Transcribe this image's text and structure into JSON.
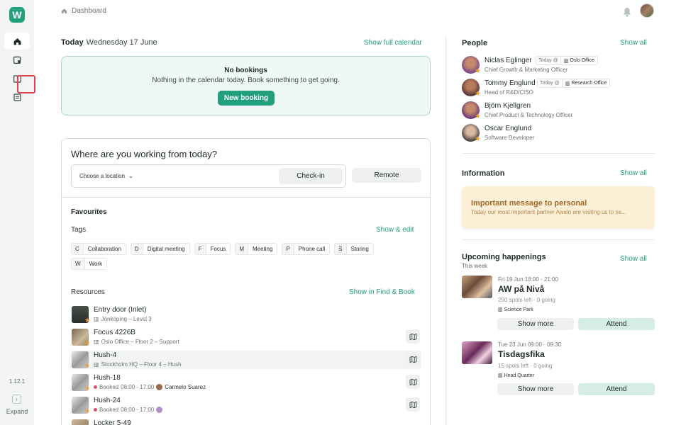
{
  "sidebar": {
    "logo": "W",
    "version": "1.12.1",
    "expand_label": "Expand",
    "expand_glyph": "›"
  },
  "breadcrumb": {
    "label": "Dashboard"
  },
  "today": {
    "label": "Today",
    "date": "Wednesday 17 June",
    "calendar_link": "Show full calendar",
    "empty_title": "No bookings",
    "empty_text": "Nothing in the calendar today. Book something to get going.",
    "new_booking": "New booking"
  },
  "work": {
    "title": "Where are you working from today?",
    "location_placeholder": "Choose a location",
    "checkin": "Check-in",
    "remote": "Remote"
  },
  "favourites": {
    "title": "Favourites",
    "tags_label": "Tags",
    "tags_link": "Show & edit",
    "tags": [
      {
        "letter": "C",
        "name": "Collaboration"
      },
      {
        "letter": "D",
        "name": "Digital meeting"
      },
      {
        "letter": "F",
        "name": "Focus"
      },
      {
        "letter": "M",
        "name": "Meeting"
      },
      {
        "letter": "P",
        "name": "Phone call"
      },
      {
        "letter": "S",
        "name": "Storing"
      },
      {
        "letter": "W",
        "name": "Work"
      }
    ],
    "resources_label": "Resources",
    "resources_link": "Show in Find & Book",
    "resources": [
      {
        "name": "Entry door (Inlet)",
        "sub": "Jönköping – Level 3"
      },
      {
        "name": "Focus 4226B",
        "sub": "Oslo Office – Floor 2 – Support"
      },
      {
        "name": "Hush-4",
        "sub": "Stockholm HQ – Floor 4 – Hush"
      },
      {
        "name": "Hush-18",
        "booked": "Booked",
        "time": "08:00 - 17:00",
        "person": "Carmelo Suarez"
      },
      {
        "name": "Hush-24",
        "booked": "Booked",
        "time": "08:00 - 17:00",
        "person": ""
      },
      {
        "name": "Locker 5-49"
      }
    ]
  },
  "people": {
    "title": "People",
    "link": "Show all",
    "items": [
      {
        "name": "Niclas Eglinger",
        "role": "Chief Growth & Marketing Officer",
        "badge_time": "Today @",
        "badge_place": "Oslo Office"
      },
      {
        "name": "Tommy Englund",
        "role": "Head of R&D/CISO",
        "badge_time": "Today @",
        "badge_place": "Research Office"
      },
      {
        "name": "Björn Kjellgren",
        "role": "Chief Product & Technology Officer"
      },
      {
        "name": "Oscar Englund",
        "role": "Software Developer"
      }
    ]
  },
  "information": {
    "title": "Information",
    "link": "Show all",
    "message_title": "Important message to personal",
    "message_text": "Today our most important partner Awalo are visiting us to se..."
  },
  "happenings": {
    "title": "Upcoming happenings",
    "link": "Show all",
    "subtitle": "This week",
    "events": [
      {
        "time": "Fri 19 Jun 18:00 - 21:00",
        "title": "AW på Nivå",
        "spots": "250 spots left · 0 going",
        "location": "Science Park",
        "more": "Show more",
        "attend": "Attend"
      },
      {
        "time": "Tue 23 Jun 09:00 - 09:30",
        "title": "Tisdagsfika",
        "spots": "15 spots left · 0 going",
        "location": "Head Quarter",
        "more": "Show more",
        "attend": "Attend"
      }
    ]
  },
  "colors": {
    "accent": "#21a07b",
    "sidebar": "#f2f5f4",
    "highlight": "#e0424f",
    "message_bg": "#fcefd6"
  }
}
